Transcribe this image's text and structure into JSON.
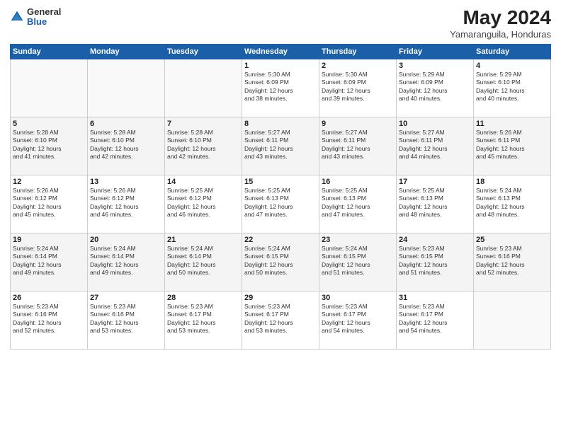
{
  "logo": {
    "general": "General",
    "blue": "Blue"
  },
  "title": "May 2024",
  "location": "Yamaranguila, Honduras",
  "days_of_week": [
    "Sunday",
    "Monday",
    "Tuesday",
    "Wednesday",
    "Thursday",
    "Friday",
    "Saturday"
  ],
  "weeks": [
    {
      "days": [
        {
          "num": "",
          "data": []
        },
        {
          "num": "",
          "data": []
        },
        {
          "num": "",
          "data": []
        },
        {
          "num": "1",
          "data": [
            "Sunrise: 5:30 AM",
            "Sunset: 6:09 PM",
            "Daylight: 12 hours",
            "and 38 minutes."
          ]
        },
        {
          "num": "2",
          "data": [
            "Sunrise: 5:30 AM",
            "Sunset: 6:09 PM",
            "Daylight: 12 hours",
            "and 39 minutes."
          ]
        },
        {
          "num": "3",
          "data": [
            "Sunrise: 5:29 AM",
            "Sunset: 6:09 PM",
            "Daylight: 12 hours",
            "and 40 minutes."
          ]
        },
        {
          "num": "4",
          "data": [
            "Sunrise: 5:29 AM",
            "Sunset: 6:10 PM",
            "Daylight: 12 hours",
            "and 40 minutes."
          ]
        }
      ]
    },
    {
      "days": [
        {
          "num": "5",
          "data": [
            "Sunrise: 5:28 AM",
            "Sunset: 6:10 PM",
            "Daylight: 12 hours",
            "and 41 minutes."
          ]
        },
        {
          "num": "6",
          "data": [
            "Sunrise: 5:28 AM",
            "Sunset: 6:10 PM",
            "Daylight: 12 hours",
            "and 42 minutes."
          ]
        },
        {
          "num": "7",
          "data": [
            "Sunrise: 5:28 AM",
            "Sunset: 6:10 PM",
            "Daylight: 12 hours",
            "and 42 minutes."
          ]
        },
        {
          "num": "8",
          "data": [
            "Sunrise: 5:27 AM",
            "Sunset: 6:11 PM",
            "Daylight: 12 hours",
            "and 43 minutes."
          ]
        },
        {
          "num": "9",
          "data": [
            "Sunrise: 5:27 AM",
            "Sunset: 6:11 PM",
            "Daylight: 12 hours",
            "and 43 minutes."
          ]
        },
        {
          "num": "10",
          "data": [
            "Sunrise: 5:27 AM",
            "Sunset: 6:11 PM",
            "Daylight: 12 hours",
            "and 44 minutes."
          ]
        },
        {
          "num": "11",
          "data": [
            "Sunrise: 5:26 AM",
            "Sunset: 6:11 PM",
            "Daylight: 12 hours",
            "and 45 minutes."
          ]
        }
      ]
    },
    {
      "days": [
        {
          "num": "12",
          "data": [
            "Sunrise: 5:26 AM",
            "Sunset: 6:12 PM",
            "Daylight: 12 hours",
            "and 45 minutes."
          ]
        },
        {
          "num": "13",
          "data": [
            "Sunrise: 5:26 AM",
            "Sunset: 6:12 PM",
            "Daylight: 12 hours",
            "and 46 minutes."
          ]
        },
        {
          "num": "14",
          "data": [
            "Sunrise: 5:25 AM",
            "Sunset: 6:12 PM",
            "Daylight: 12 hours",
            "and 46 minutes."
          ]
        },
        {
          "num": "15",
          "data": [
            "Sunrise: 5:25 AM",
            "Sunset: 6:13 PM",
            "Daylight: 12 hours",
            "and 47 minutes."
          ]
        },
        {
          "num": "16",
          "data": [
            "Sunrise: 5:25 AM",
            "Sunset: 6:13 PM",
            "Daylight: 12 hours",
            "and 47 minutes."
          ]
        },
        {
          "num": "17",
          "data": [
            "Sunrise: 5:25 AM",
            "Sunset: 6:13 PM",
            "Daylight: 12 hours",
            "and 48 minutes."
          ]
        },
        {
          "num": "18",
          "data": [
            "Sunrise: 5:24 AM",
            "Sunset: 6:13 PM",
            "Daylight: 12 hours",
            "and 48 minutes."
          ]
        }
      ]
    },
    {
      "days": [
        {
          "num": "19",
          "data": [
            "Sunrise: 5:24 AM",
            "Sunset: 6:14 PM",
            "Daylight: 12 hours",
            "and 49 minutes."
          ]
        },
        {
          "num": "20",
          "data": [
            "Sunrise: 5:24 AM",
            "Sunset: 6:14 PM",
            "Daylight: 12 hours",
            "and 49 minutes."
          ]
        },
        {
          "num": "21",
          "data": [
            "Sunrise: 5:24 AM",
            "Sunset: 6:14 PM",
            "Daylight: 12 hours",
            "and 50 minutes."
          ]
        },
        {
          "num": "22",
          "data": [
            "Sunrise: 5:24 AM",
            "Sunset: 6:15 PM",
            "Daylight: 12 hours",
            "and 50 minutes."
          ]
        },
        {
          "num": "23",
          "data": [
            "Sunrise: 5:24 AM",
            "Sunset: 6:15 PM",
            "Daylight: 12 hours",
            "and 51 minutes."
          ]
        },
        {
          "num": "24",
          "data": [
            "Sunrise: 5:23 AM",
            "Sunset: 6:15 PM",
            "Daylight: 12 hours",
            "and 51 minutes."
          ]
        },
        {
          "num": "25",
          "data": [
            "Sunrise: 5:23 AM",
            "Sunset: 6:16 PM",
            "Daylight: 12 hours",
            "and 52 minutes."
          ]
        }
      ]
    },
    {
      "days": [
        {
          "num": "26",
          "data": [
            "Sunrise: 5:23 AM",
            "Sunset: 6:16 PM",
            "Daylight: 12 hours",
            "and 52 minutes."
          ]
        },
        {
          "num": "27",
          "data": [
            "Sunrise: 5:23 AM",
            "Sunset: 6:16 PM",
            "Daylight: 12 hours",
            "and 53 minutes."
          ]
        },
        {
          "num": "28",
          "data": [
            "Sunrise: 5:23 AM",
            "Sunset: 6:17 PM",
            "Daylight: 12 hours",
            "and 53 minutes."
          ]
        },
        {
          "num": "29",
          "data": [
            "Sunrise: 5:23 AM",
            "Sunset: 6:17 PM",
            "Daylight: 12 hours",
            "and 53 minutes."
          ]
        },
        {
          "num": "30",
          "data": [
            "Sunrise: 5:23 AM",
            "Sunset: 6:17 PM",
            "Daylight: 12 hours",
            "and 54 minutes."
          ]
        },
        {
          "num": "31",
          "data": [
            "Sunrise: 5:23 AM",
            "Sunset: 6:17 PM",
            "Daylight: 12 hours",
            "and 54 minutes."
          ]
        },
        {
          "num": "",
          "data": []
        }
      ]
    }
  ]
}
